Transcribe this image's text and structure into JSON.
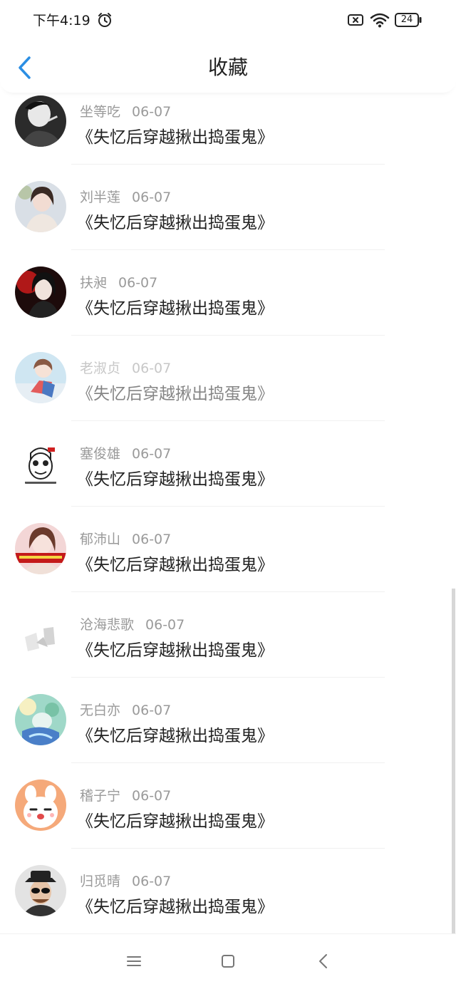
{
  "status_bar": {
    "time": "下午4:19",
    "battery": "24",
    "icons": [
      "alarm-icon",
      "sim-error-icon",
      "wifi-icon",
      "battery-icon"
    ]
  },
  "header": {
    "title": "收藏",
    "back_icon": "chevron-left-icon",
    "accent_color": "#2b8ee3"
  },
  "favorites": [
    {
      "user": "坐等吃",
      "date": "06-07",
      "book": "《失忆后穿越揪出捣蛋鬼》"
    },
    {
      "user": "刘半莲",
      "date": "06-07",
      "book": "《失忆后穿越揪出捣蛋鬼》"
    },
    {
      "user": "扶昶",
      "date": "06-07",
      "book": "《失忆后穿越揪出捣蛋鬼》"
    },
    {
      "user": "老淑贞",
      "date": "06-07",
      "book": "《失忆后穿越揪出捣蛋鬼》"
    },
    {
      "user": "塞俊雄",
      "date": "06-07",
      "book": "《失忆后穿越揪出捣蛋鬼》"
    },
    {
      "user": "郁沛山",
      "date": "06-07",
      "book": "《失忆后穿越揪出捣蛋鬼》"
    },
    {
      "user": "沧海悲歌",
      "date": "06-07",
      "book": "《失忆后穿越揪出捣蛋鬼》"
    },
    {
      "user": "无白亦",
      "date": "06-07",
      "book": "《失忆后穿越揪出捣蛋鬼》"
    },
    {
      "user": "稽子宁",
      "date": "06-07",
      "book": "《失忆后穿越揪出捣蛋鬼》"
    },
    {
      "user": "归觅晴",
      "date": "06-07",
      "book": "《失忆后穿越揪出捣蛋鬼》"
    }
  ],
  "nav_bar": {
    "icons": [
      "menu-icon",
      "home-square-icon",
      "back-triangle-icon"
    ]
  }
}
